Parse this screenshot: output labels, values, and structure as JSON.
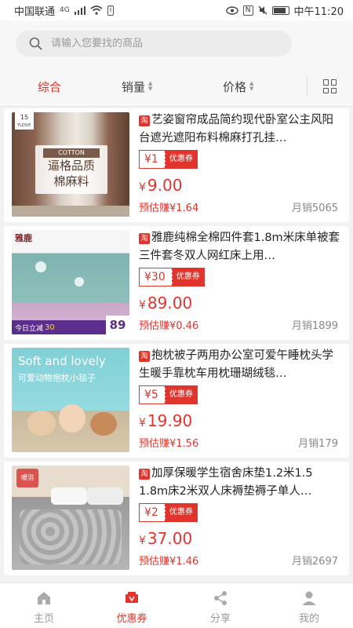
{
  "status_bar": {
    "carrier": "中国联通",
    "signal": "4G",
    "time": "中午11:20"
  },
  "search": {
    "placeholder": "请输入您要找的商品"
  },
  "sort": {
    "tabs": [
      "综合",
      "销量",
      "价格"
    ]
  },
  "products": [
    {
      "tag": "淘",
      "title": "艺姿窗帘成品简约现代卧室公主风阳台遮光遮阳布料棉麻打孔挂…",
      "coupon": "¥1",
      "coupon_label": "优惠券",
      "price_symbol": "¥",
      "price": "9.00",
      "earn": "预估赚¥1.64",
      "sales": "月销5065",
      "image_text": {
        "badge_top": "15",
        "badge_sub": "YLDS®",
        "badge_en": "COTTON",
        "line1": "逼格品质",
        "line2": "棉麻料"
      }
    },
    {
      "tag": "淘",
      "title": "雅鹿纯棉全棉四件套1.8m米床单被套三件套冬双人网红床上用…",
      "coupon": "¥30",
      "coupon_label": "优惠券",
      "price_symbol": "¥",
      "price": "89.00",
      "earn": "预估赚¥0.46",
      "sales": "月销1899",
      "image_text": {
        "brand": "雅鹿",
        "promo": "今日立减",
        "promo_amount": "30",
        "price": "89"
      }
    },
    {
      "tag": "淘",
      "title": "抱枕被子两用办公室可爱午睡枕头学生暖手靠枕车用枕珊瑚绒毯…",
      "coupon": "¥5",
      "coupon_label": "优惠券",
      "price_symbol": "¥",
      "price": "19.90",
      "earn": "预估赚¥1.56",
      "sales": "月销179",
      "image_text": {
        "line1": "Soft and lovely",
        "line2": "可爱动物抱枕小毯子"
      }
    },
    {
      "tag": "淘",
      "title": "加厚保暖学生宿舍床垫1.2米1.5 1.8m床2米双人床褥垫褥子单人…",
      "coupon": "¥2",
      "coupon_label": "优惠券",
      "price_symbol": "¥",
      "price": "37.00",
      "earn": "预估赚¥1.46",
      "sales": "月销2697",
      "image_text": {
        "logo": "暖羽"
      }
    }
  ],
  "tab_bar": {
    "items": [
      {
        "label": "主页",
        "icon": "home-icon"
      },
      {
        "label": "优惠券",
        "icon": "coupon-icon"
      },
      {
        "label": "分享",
        "icon": "share-icon"
      },
      {
        "label": "我的",
        "icon": "user-icon"
      }
    ],
    "active_index": 1
  },
  "colors": {
    "accent": "#e0342c",
    "background": "#f2f2f2"
  }
}
